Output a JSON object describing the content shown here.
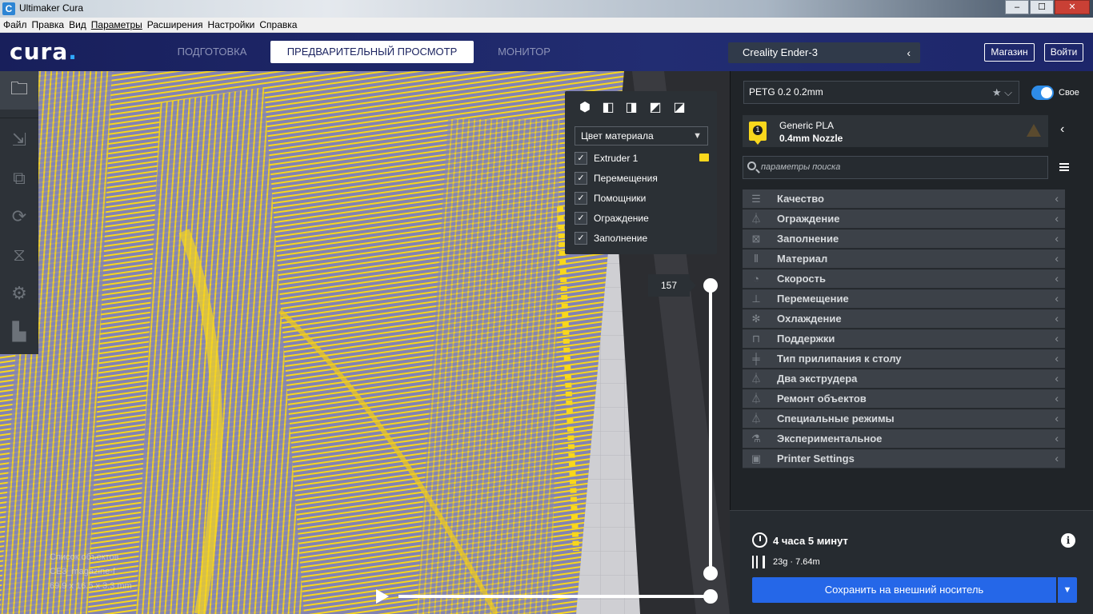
{
  "window": {
    "title": "Ultimaker Cura",
    "app_icon": "C",
    "buttons": [
      "–",
      "☐",
      "✕"
    ]
  },
  "menu": [
    "Файл",
    "Правка",
    "Вид",
    "Параметры",
    "Расширения",
    "Настройки",
    "Справка"
  ],
  "header": {
    "logo": "cura",
    "stages": {
      "prepare": "ПОДГОТОВКА",
      "preview": "ПРЕДВАРИТЕЛЬНЫЙ ПРОСМОТР",
      "monitor": "МОНИТОР"
    },
    "printer": "Creality Ender-3",
    "marketplace": "Магазин",
    "signin": "Войти"
  },
  "view_panel": {
    "color_scheme": "Цвет материала",
    "rows": [
      "Extruder 1",
      "Перемещения",
      "Помощники",
      "Ограждение",
      "Заполнение"
    ],
    "extruder_color": "#f9d71c"
  },
  "layer": {
    "current": "157"
  },
  "object_list": {
    "label": "Список объектов",
    "file": "CE3_magazine-f",
    "size": "69.9 x 16.5 x 3.3 mm"
  },
  "settings": {
    "profile": "PETG 0.2   0.2mm",
    "custom_label": "Свое",
    "material": "Generic PLA",
    "nozzle": "0.4mm Nozzle",
    "extruder_number": "1",
    "search_placeholder": "параметры поиска",
    "categories": [
      {
        "label": "Качество",
        "icon": "quality-icon"
      },
      {
        "label": "Ограждение",
        "icon": "shell-icon"
      },
      {
        "label": "Заполнение",
        "icon": "infill-icon"
      },
      {
        "label": "Материал",
        "icon": "material-icon"
      },
      {
        "label": "Скорость",
        "icon": "speed-icon"
      },
      {
        "label": "Перемещение",
        "icon": "travel-icon"
      },
      {
        "label": "Охлаждение",
        "icon": "cooling-icon"
      },
      {
        "label": "Поддержки",
        "icon": "support-icon"
      },
      {
        "label": "Тип прилипания к столу",
        "icon": "adhesion-icon"
      },
      {
        "label": "Два экструдера",
        "icon": "dual-extruder-icon"
      },
      {
        "label": "Ремонт объектов",
        "icon": "mesh-fix-icon"
      },
      {
        "label": "Специальные режимы",
        "icon": "special-modes-icon"
      },
      {
        "label": "Экспериментальное",
        "icon": "experimental-icon"
      },
      {
        "label": "Printer Settings",
        "icon": "printer-settings-icon"
      }
    ]
  },
  "print": {
    "time": "4 часа 5 минут",
    "material_usage": "23g · 7.64m",
    "save_button": "Сохранить на внешний носитель"
  },
  "colors": {
    "accent": "#2567e8",
    "header": "#1f2a6b",
    "infill": "#f9d71c",
    "model": "#8283b4"
  }
}
